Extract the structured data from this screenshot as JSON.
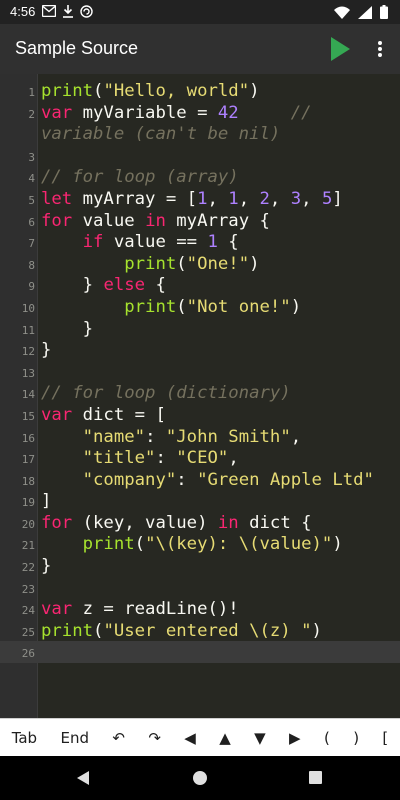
{
  "status_bar": {
    "time": "4:56",
    "icons_left": [
      "gmail-icon",
      "download-icon",
      "sync-icon"
    ],
    "icons_right": [
      "wifi-icon",
      "signal-icon",
      "battery-icon"
    ]
  },
  "app_bar": {
    "title": "Sample Source",
    "run_icon": "play-icon",
    "menu_icon": "more-vert-icon"
  },
  "colors": {
    "background": "#272822",
    "function": "#a6e22e",
    "string": "#e6db74",
    "keyword": "#f92672",
    "number": "#ae81ff",
    "comment": "#75715e",
    "plain": "#f8f8f2",
    "run_button": "#35a853"
  },
  "editor": {
    "current_line": 26,
    "lines": [
      {
        "n": "1",
        "tokens": [
          [
            "fn",
            "print"
          ],
          [
            "plain",
            "("
          ],
          [
            "str",
            "\"Hello, world\""
          ],
          [
            "plain",
            ")"
          ]
        ]
      },
      {
        "n": "2",
        "tokens": [
          [
            "kw",
            "var"
          ],
          [
            "plain",
            " myVariable = "
          ],
          [
            "num",
            "42"
          ],
          [
            "plain",
            "     "
          ],
          [
            "com",
            "//"
          ]
        ]
      },
      {
        "n": "",
        "tokens": [
          [
            "com",
            "variable (can't be nil)"
          ]
        ]
      },
      {
        "n": "3",
        "tokens": []
      },
      {
        "n": "4",
        "tokens": [
          [
            "com",
            "// for loop (array)"
          ]
        ]
      },
      {
        "n": "5",
        "tokens": [
          [
            "kw",
            "let"
          ],
          [
            "plain",
            " myArray = ["
          ],
          [
            "num",
            "1"
          ],
          [
            "plain",
            ", "
          ],
          [
            "num",
            "1"
          ],
          [
            "plain",
            ", "
          ],
          [
            "num",
            "2"
          ],
          [
            "plain",
            ", "
          ],
          [
            "num",
            "3"
          ],
          [
            "plain",
            ", "
          ],
          [
            "num",
            "5"
          ],
          [
            "plain",
            "]"
          ]
        ]
      },
      {
        "n": "6",
        "tokens": [
          [
            "kw",
            "for"
          ],
          [
            "plain",
            " value "
          ],
          [
            "kw",
            "in"
          ],
          [
            "plain",
            " myArray {"
          ]
        ]
      },
      {
        "n": "7",
        "tokens": [
          [
            "plain",
            "    "
          ],
          [
            "kw",
            "if"
          ],
          [
            "plain",
            " value == "
          ],
          [
            "num",
            "1"
          ],
          [
            "plain",
            " {"
          ]
        ]
      },
      {
        "n": "8",
        "tokens": [
          [
            "plain",
            "        "
          ],
          [
            "fn",
            "print"
          ],
          [
            "plain",
            "("
          ],
          [
            "str",
            "\"One!\""
          ],
          [
            "plain",
            ")"
          ]
        ]
      },
      {
        "n": "9",
        "tokens": [
          [
            "plain",
            "    } "
          ],
          [
            "kw",
            "else"
          ],
          [
            "plain",
            " {"
          ]
        ]
      },
      {
        "n": "10",
        "tokens": [
          [
            "plain",
            "        "
          ],
          [
            "fn",
            "print"
          ],
          [
            "plain",
            "("
          ],
          [
            "str",
            "\"Not one!\""
          ],
          [
            "plain",
            ")"
          ]
        ]
      },
      {
        "n": "11",
        "tokens": [
          [
            "plain",
            "    }"
          ]
        ]
      },
      {
        "n": "12",
        "tokens": [
          [
            "plain",
            "}"
          ]
        ]
      },
      {
        "n": "13",
        "tokens": []
      },
      {
        "n": "14",
        "tokens": [
          [
            "com",
            "// for loop (dictionary)"
          ]
        ]
      },
      {
        "n": "15",
        "tokens": [
          [
            "kw",
            "var"
          ],
          [
            "plain",
            " dict = ["
          ]
        ]
      },
      {
        "n": "16",
        "tokens": [
          [
            "plain",
            "    "
          ],
          [
            "str",
            "\"name\""
          ],
          [
            "plain",
            ": "
          ],
          [
            "str",
            "\"John Smith\""
          ],
          [
            "plain",
            ","
          ]
        ]
      },
      {
        "n": "17",
        "tokens": [
          [
            "plain",
            "    "
          ],
          [
            "str",
            "\"title\""
          ],
          [
            "plain",
            ": "
          ],
          [
            "str",
            "\"CEO\""
          ],
          [
            "plain",
            ","
          ]
        ]
      },
      {
        "n": "18",
        "tokens": [
          [
            "plain",
            "    "
          ],
          [
            "str",
            "\"company\""
          ],
          [
            "plain",
            ": "
          ],
          [
            "str",
            "\"Green Apple Ltd\""
          ]
        ]
      },
      {
        "n": "19",
        "tokens": [
          [
            "plain",
            "]"
          ]
        ]
      },
      {
        "n": "20",
        "tokens": [
          [
            "kw",
            "for"
          ],
          [
            "plain",
            " (key, value) "
          ],
          [
            "kw",
            "in"
          ],
          [
            "plain",
            " dict {"
          ]
        ]
      },
      {
        "n": "21",
        "tokens": [
          [
            "plain",
            "    "
          ],
          [
            "fn",
            "print"
          ],
          [
            "plain",
            "("
          ],
          [
            "str",
            "\"\\(key): \\(value)\""
          ],
          [
            "plain",
            ")"
          ]
        ]
      },
      {
        "n": "22",
        "tokens": [
          [
            "plain",
            "}"
          ]
        ]
      },
      {
        "n": "23",
        "tokens": []
      },
      {
        "n": "24",
        "tokens": [
          [
            "kw",
            "var"
          ],
          [
            "plain",
            " z = readLine()!"
          ]
        ]
      },
      {
        "n": "25",
        "tokens": [
          [
            "fn",
            "print"
          ],
          [
            "plain",
            "("
          ],
          [
            "str",
            "\"User entered \\(z) \""
          ],
          [
            "plain",
            ")"
          ]
        ]
      },
      {
        "n": "26",
        "tokens": []
      }
    ]
  },
  "keys_bar": {
    "keys": [
      {
        "label": "Tab",
        "name": "tab-key"
      },
      {
        "label": "End",
        "name": "end-key"
      },
      {
        "label": "↶",
        "name": "undo-key"
      },
      {
        "label": "↷",
        "name": "redo-key"
      },
      {
        "label": "◀",
        "name": "cursor-left-key"
      },
      {
        "label": "▲",
        "name": "cursor-up-key"
      },
      {
        "label": "▼",
        "name": "cursor-down-key"
      },
      {
        "label": "▶",
        "name": "cursor-right-key"
      },
      {
        "label": "(",
        "name": "open-paren-key"
      },
      {
        "label": ")",
        "name": "close-paren-key"
      },
      {
        "label": "[",
        "name": "open-bracket-key"
      }
    ]
  },
  "nav_bar": {
    "icons": [
      "back-icon",
      "home-icon",
      "recents-icon"
    ]
  }
}
